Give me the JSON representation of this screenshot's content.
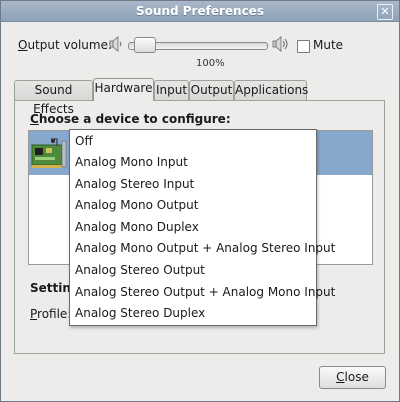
{
  "window": {
    "title": "Sound Preferences",
    "close_glyph": "✕"
  },
  "volume": {
    "label_mnemonic": "O",
    "label_rest": "utput volume:",
    "level_percent": 100,
    "percent_text": "100%",
    "mute_label": "Mute",
    "mute_checked": false,
    "low_icon": "speaker-low-icon",
    "high_icon": "speaker-high-icon"
  },
  "tabs": [
    {
      "label": "Sound Effects",
      "active": false
    },
    {
      "label": "Hardware",
      "active": true
    },
    {
      "label": "Input",
      "active": false
    },
    {
      "label": "Output",
      "active": false
    },
    {
      "label": "Applications",
      "active": false
    }
  ],
  "hardware": {
    "choose_mnemonic": "C",
    "choose_rest": "hoose a device to configure:",
    "settings_label": "Setting",
    "profile_mnemonic": "P",
    "profile_rest": "rofile:",
    "device_icon": "sound-card-icon"
  },
  "profile_menu": {
    "items": [
      "Off",
      "Analog Mono Input",
      "Analog Stereo Input",
      "Analog Mono Output",
      "Analog Mono Duplex",
      "Analog Mono Output + Analog Stereo Input",
      "Analog Stereo Output",
      "Analog Stereo Output + Analog Mono Input",
      "Analog Stereo Duplex"
    ]
  },
  "footer": {
    "close_mnemonic": "C",
    "close_rest": "lose"
  },
  "colors": {
    "selection": "#86a8cc",
    "titlebar": "#9aabbf"
  }
}
